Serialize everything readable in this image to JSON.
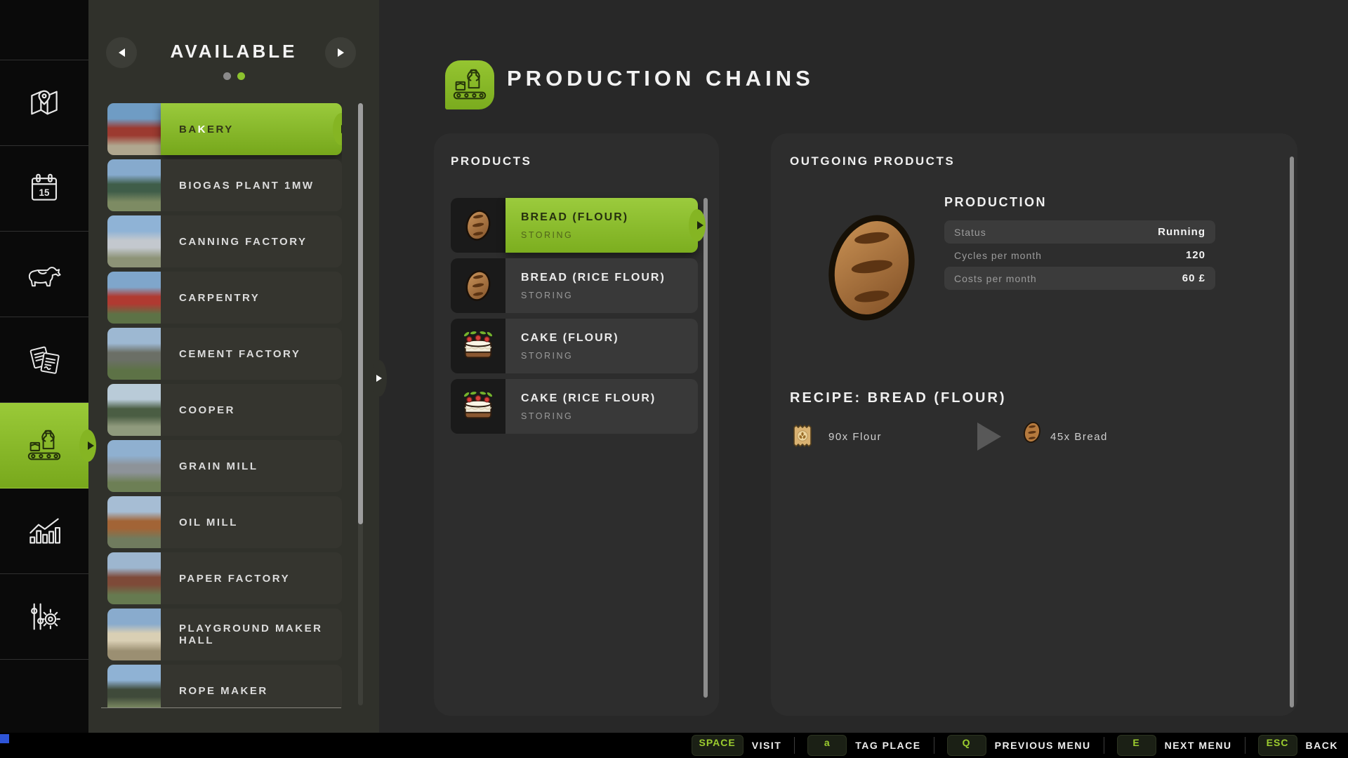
{
  "colors": {
    "accent_green": "#8cc22e",
    "key_green": "#9ccd2f",
    "panel_bg": "#2d2d2d",
    "sidebar_bg": "#0a0a0a"
  },
  "sidebar": {
    "items": [
      {
        "id": "map",
        "icon": "map-icon"
      },
      {
        "id": "calendar",
        "icon": "calendar-icon",
        "badge": "15"
      },
      {
        "id": "animals",
        "icon": "cow-icon"
      },
      {
        "id": "contracts",
        "icon": "documents-icon"
      },
      {
        "id": "production",
        "icon": "production-icon",
        "active": true
      },
      {
        "id": "statistics",
        "icon": "stats-icon"
      },
      {
        "id": "settings",
        "icon": "settings-icon"
      }
    ]
  },
  "available_panel": {
    "title": "AVAILABLE",
    "page_dots": [
      {
        "active": false
      },
      {
        "active": true
      }
    ],
    "buildings": [
      {
        "label": "BAKERY",
        "label_parts": {
          "pre": "BA",
          "hl": "K",
          "post": "ERY"
        },
        "selected": true,
        "thumb": [
          "#6f9cc4",
          "#9c3a30",
          "#b0a78f"
        ]
      },
      {
        "label": "BIOGAS PLANT 1MW",
        "thumb": [
          "#86aacd",
          "#3f5d49",
          "#7d8b63"
        ]
      },
      {
        "label": "CANNING FACTORY",
        "thumb": [
          "#8fb3d6",
          "#c3c8ce",
          "#8d9377"
        ]
      },
      {
        "label": "CARPENTRY",
        "thumb": [
          "#7fa6cb",
          "#b03a31",
          "#5d7246"
        ]
      },
      {
        "label": "CEMENT FACTORY",
        "thumb": [
          "#9db8d2",
          "#6b6f66",
          "#5d7246"
        ]
      },
      {
        "label": "COOPER",
        "thumb": [
          "#b9cbd8",
          "#4a5d43",
          "#8f9a7d"
        ]
      },
      {
        "label": "GRAIN MILL",
        "thumb": [
          "#8fb0d0",
          "#8d9399",
          "#6d7f55"
        ]
      },
      {
        "label": "OIL MILL",
        "thumb": [
          "#a6bdd4",
          "#a26436",
          "#707b5e"
        ]
      },
      {
        "label": "PAPER FACTORY",
        "thumb": [
          "#9db6cf",
          "#7e4a38",
          "#667a50"
        ]
      },
      {
        "label": "PLAYGROUND MAKER HALL",
        "thumb": [
          "#89abcd",
          "#d9cfb4",
          "#9b8f72"
        ]
      },
      {
        "label": "ROPE MAKER",
        "thumb": [
          "#8fb2d4",
          "#3f4a3a",
          "#77855f"
        ]
      }
    ]
  },
  "header": {
    "title": "PRODUCTION CHAINS",
    "icon": "production-icon"
  },
  "products_panel": {
    "title": "PRODUCTS",
    "items": [
      {
        "label": "BREAD (FLOUR)",
        "status": "STORING",
        "icon": "bread-icon",
        "selected": true
      },
      {
        "label": "BREAD (RICE FLOUR)",
        "status": "STORING",
        "icon": "bread-icon"
      },
      {
        "label": "CAKE (FLOUR)",
        "status": "STORING",
        "icon": "cake-icon"
      },
      {
        "label": "CAKE (RICE FLOUR)",
        "status": "STORING",
        "icon": "cake-icon"
      }
    ]
  },
  "outgoing_panel": {
    "title": "OUTGOING PRODUCTS",
    "product_image": "bread-image",
    "production": {
      "title": "PRODUCTION",
      "rows": [
        {
          "label": "Status",
          "value": "Running"
        },
        {
          "label": "Cycles per month",
          "value": "120"
        },
        {
          "label": "Costs per month",
          "value": "60 £"
        }
      ]
    },
    "recipe": {
      "title": "RECIPE: BREAD (FLOUR)",
      "input": "90x Flour",
      "input_icon": "flour-bag-icon",
      "output": "45x Bread",
      "output_icon": "bread-icon"
    }
  },
  "hotkeys": [
    {
      "key": "SPACE",
      "action": "VISIT"
    },
    {
      "key": "a",
      "action": "TAG PLACE"
    },
    {
      "key": "Q",
      "action": "PREVIOUS MENU"
    },
    {
      "key": "E",
      "action": "NEXT MENU"
    },
    {
      "key": "ESC",
      "action": "BACK"
    }
  ]
}
